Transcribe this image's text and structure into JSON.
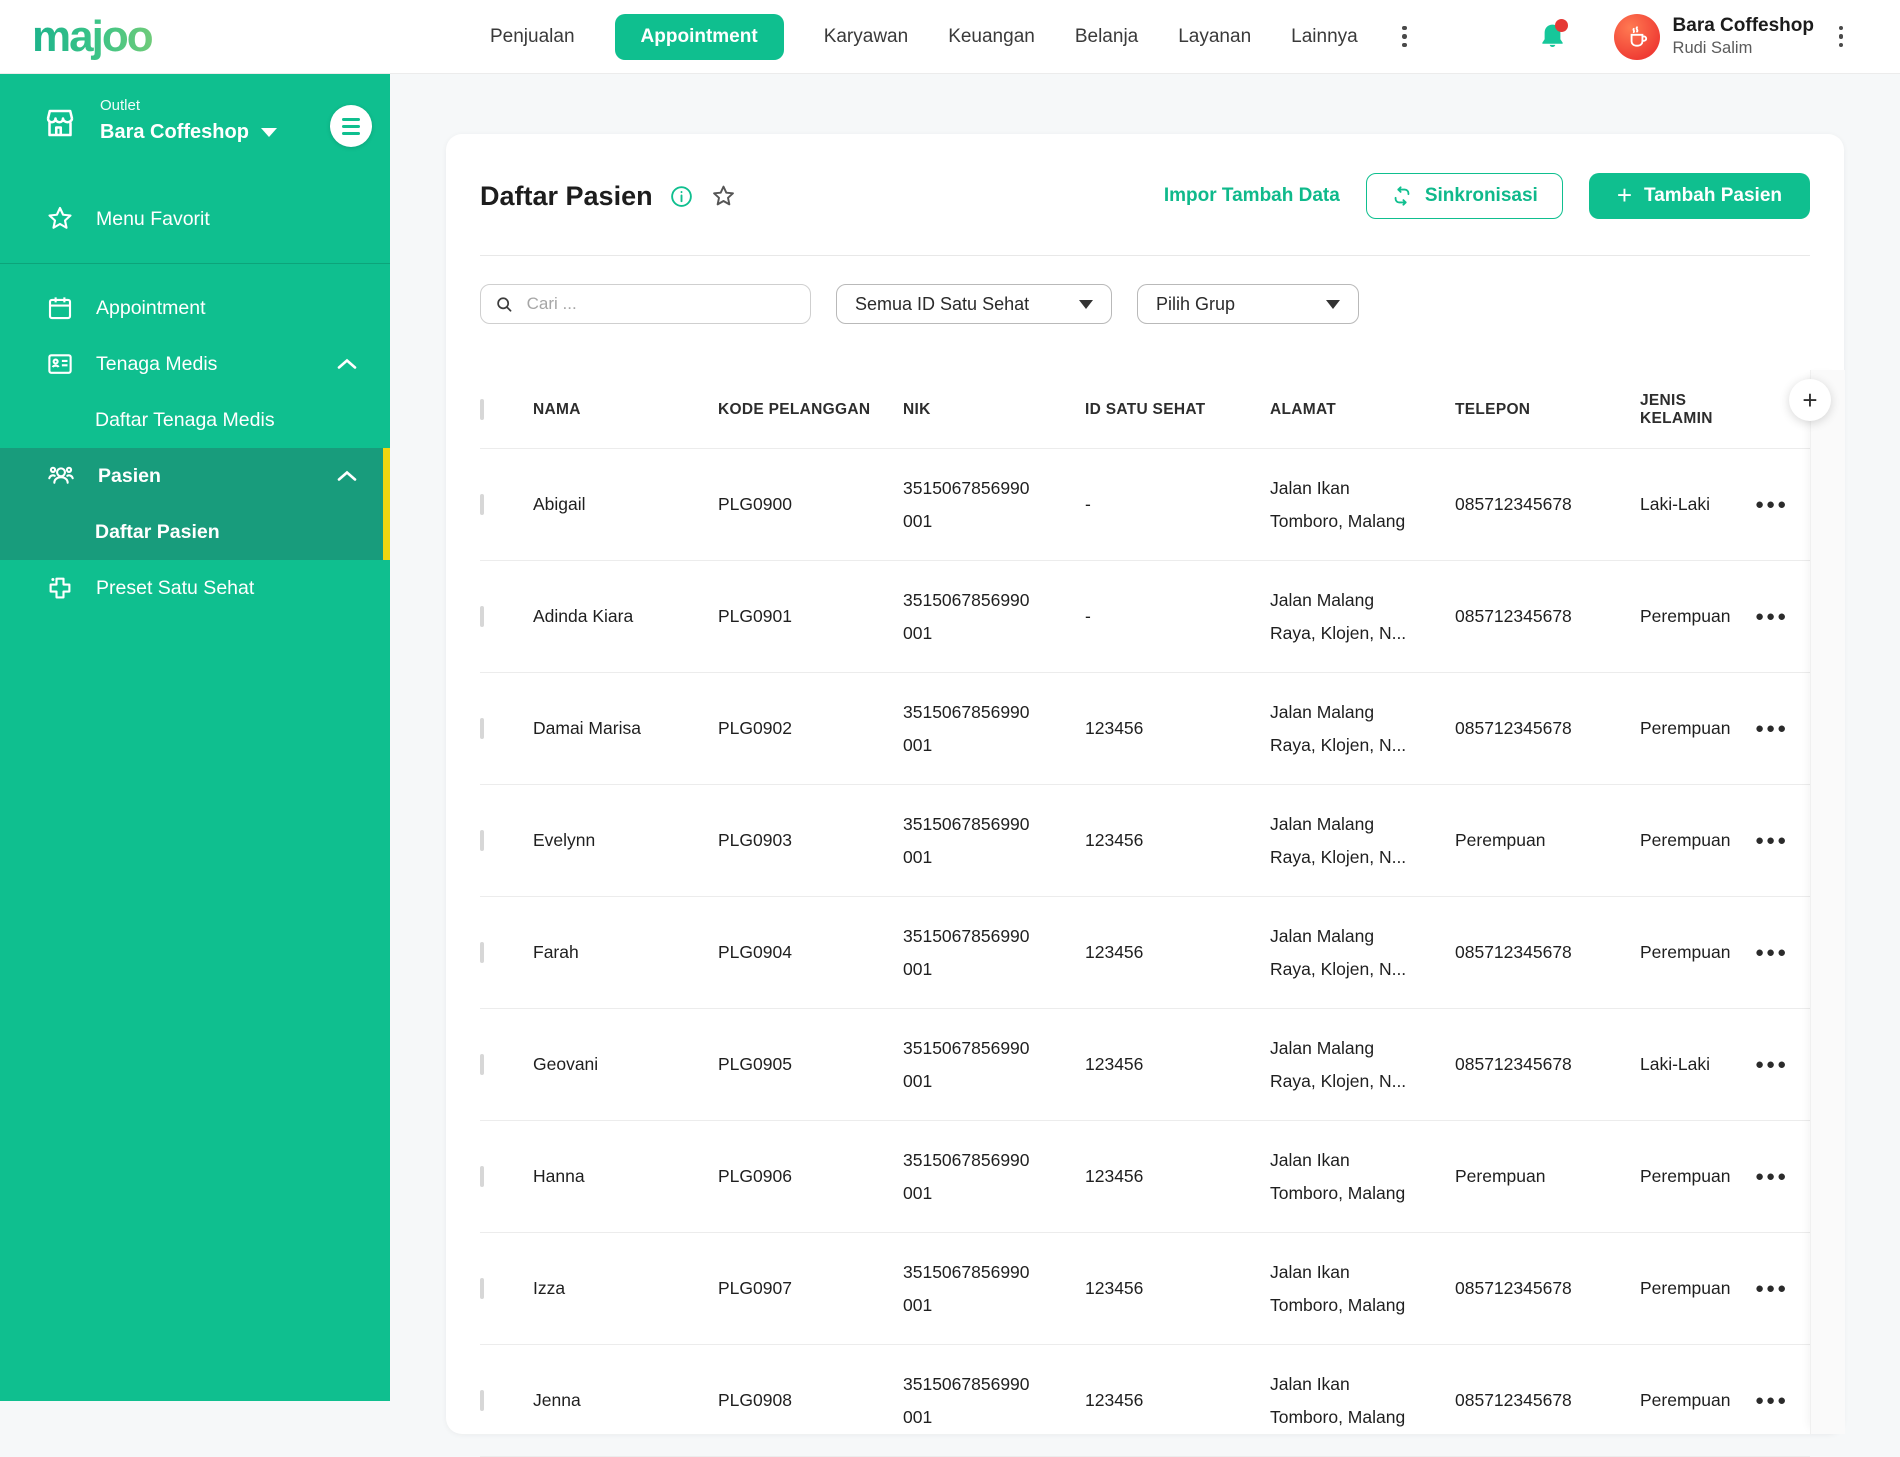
{
  "brand": {
    "logo_text": "majoo"
  },
  "navbar": {
    "items": [
      {
        "label": "Penjualan",
        "active": false
      },
      {
        "label": "Appointment",
        "active": true
      },
      {
        "label": "Karyawan",
        "active": false
      },
      {
        "label": "Keuangan",
        "active": false
      },
      {
        "label": "Belanja",
        "active": false
      },
      {
        "label": "Layanan",
        "active": false
      },
      {
        "label": "Lainnya",
        "active": false
      }
    ],
    "profile": {
      "business_name": "Bara Coffeshop",
      "user_name": "Rudi Salim"
    }
  },
  "sidebar": {
    "outlet_label": "Outlet",
    "outlet_name": "Bara Coffeshop",
    "favorit": "Menu Favorit",
    "appointment": "Appointment",
    "tenaga_medis": "Tenaga Medis",
    "daftar_tenaga_medis": "Daftar Tenaga Medis",
    "pasien": "Pasien",
    "daftar_pasien": "Daftar Pasien",
    "preset_satu_sehat": "Preset Satu Sehat"
  },
  "page": {
    "title": "Daftar Pasien",
    "import_link": "Impor Tambah Data",
    "sync_button": "Sinkronisasi",
    "add_button": "Tambah Pasien"
  },
  "filters": {
    "search_placeholder": "Cari ...",
    "id_satu_sehat_filter": "Semua ID Satu Sehat",
    "group_filter": "Pilih Grup"
  },
  "table": {
    "columns": [
      "NAMA",
      "KODE PELANGGAN",
      "NIK",
      "ID SATU SEHAT",
      "ALAMAT",
      "TELEPON",
      "JENIS KELAMIN"
    ],
    "rows": [
      {
        "name": "Abigail",
        "kode": "PLG0900",
        "nik": "3515067856990\n001",
        "id_satu_sehat": "-",
        "alamat": "Jalan Ikan\nTomboro, Malang",
        "telepon": "085712345678",
        "jenis_kelamin": "Laki-Laki"
      },
      {
        "name": "Adinda Kiara",
        "kode": "PLG0901",
        "nik": "3515067856990\n001",
        "id_satu_sehat": "-",
        "alamat": "Jalan Malang\nRaya, Klojen, N...",
        "telepon": "085712345678",
        "jenis_kelamin": "Perempuan"
      },
      {
        "name": "Damai Marisa",
        "kode": "PLG0902",
        "nik": "3515067856990\n001",
        "id_satu_sehat": "123456",
        "alamat": "Jalan Malang\nRaya, Klojen, N...",
        "telepon": "085712345678",
        "jenis_kelamin": "Perempuan"
      },
      {
        "name": "Evelynn",
        "kode": "PLG0903",
        "nik": "3515067856990\n001",
        "id_satu_sehat": "123456",
        "alamat": "Jalan Malang\nRaya, Klojen, N...",
        "telepon": "Perempuan",
        "jenis_kelamin": "Perempuan"
      },
      {
        "name": "Farah",
        "kode": "PLG0904",
        "nik": "3515067856990\n001",
        "id_satu_sehat": "123456",
        "alamat": "Jalan Malang\nRaya, Klojen, N...",
        "telepon": "085712345678",
        "jenis_kelamin": "Perempuan"
      },
      {
        "name": "Geovani",
        "kode": "PLG0905",
        "nik": "3515067856990\n001",
        "id_satu_sehat": "123456",
        "alamat": "Jalan Malang\nRaya, Klojen, N...",
        "telepon": "085712345678",
        "jenis_kelamin": "Laki-Laki"
      },
      {
        "name": "Hanna",
        "kode": "PLG0906",
        "nik": "3515067856990\n001",
        "id_satu_sehat": "123456",
        "alamat": "Jalan Ikan\nTomboro, Malang",
        "telepon": "Perempuan",
        "jenis_kelamin": "Perempuan"
      },
      {
        "name": "Izza",
        "kode": "PLG0907",
        "nik": "3515067856990\n001",
        "id_satu_sehat": "123456",
        "alamat": "Jalan Ikan\nTomboro, Malang",
        "telepon": "085712345678",
        "jenis_kelamin": "Perempuan"
      },
      {
        "name": "Jenna",
        "kode": "PLG0908",
        "nik": "3515067856990\n001",
        "id_satu_sehat": "123456",
        "alamat": "Jalan Ikan\nTomboro, Malang",
        "telepon": "085712345678",
        "jenis_kelamin": "Perempuan"
      }
    ]
  },
  "colors": {
    "accent": "#0FBF8F",
    "sidebar_active": "#189C7C",
    "active_indicator": "#F2D50F",
    "notification_bell": "#16C79A",
    "notification_badge": "#E53935",
    "avatar_bg": "#EF3B33"
  },
  "icons": {
    "nav_overflow": "kebab-menu-icon",
    "notification": "bell-icon",
    "profile_menu": "kebab-menu-icon",
    "outlet": "storefront-icon",
    "sidebar_toggle": "hamburger-icon",
    "menu_favorit": "star-icon",
    "appointment": "calendar-icon",
    "tenaga_medis": "id-card-icon",
    "pasien": "people-icon",
    "preset_satu_sehat": "medical-cross-icon",
    "title_info": "info-icon",
    "title_favorite": "star-outline-icon",
    "sync": "sync-icon",
    "add": "plus-icon",
    "search": "search-icon",
    "dropdown": "caret-down-icon",
    "row_actions": "ellipsis-icon",
    "add_column": "plus-icon"
  }
}
